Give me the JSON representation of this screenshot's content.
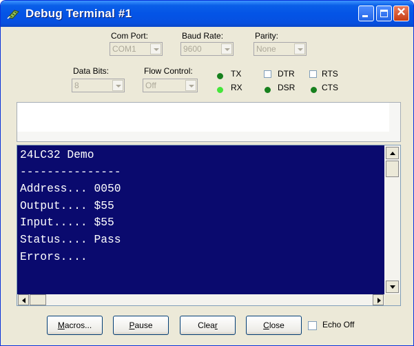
{
  "window": {
    "title": "Debug Terminal #1"
  },
  "settings": {
    "com_port": {
      "label": "Com Port:",
      "value": "COM1"
    },
    "baud_rate": {
      "label": "Baud Rate:",
      "value": "9600"
    },
    "parity": {
      "label": "Parity:",
      "value": "None"
    },
    "data_bits": {
      "label": "Data Bits:",
      "value": "8"
    },
    "flow_control": {
      "label": "Flow Control:",
      "value": "Off"
    }
  },
  "signals": {
    "tx": {
      "label": "TX",
      "state": "off"
    },
    "rx": {
      "label": "RX",
      "state": "on"
    },
    "dtr": {
      "label": "DTR",
      "checked": false
    },
    "rts": {
      "label": "RTS",
      "checked": false
    },
    "dsr": {
      "label": "DSR",
      "state": "off"
    },
    "cts": {
      "label": "CTS",
      "state": "off"
    }
  },
  "terminal": {
    "lines": [
      "24LC32 Demo",
      "---------------",
      "Address... 0050",
      "Output.... $55",
      "Input..... $55",
      "Status.... Pass",
      "Errors...."
    ]
  },
  "buttons": {
    "macros": {
      "label": "Macros...",
      "mnemonic": "M",
      "rest": "acros..."
    },
    "pause": {
      "label": "Pause",
      "mnemonic": "P",
      "rest": "ause"
    },
    "clear": {
      "label": "Clear",
      "lead": "Clea",
      "mnemonic": "r"
    },
    "close": {
      "label": "Close",
      "mnemonic": "C",
      "rest": "lose"
    },
    "echo_off": {
      "label": "Echo Off",
      "checked": false
    }
  },
  "colors": {
    "terminal_bg": "#0a0a6e",
    "terminal_fg": "#ffffff",
    "led_on": "#45e63a",
    "led_off": "#17801e"
  }
}
